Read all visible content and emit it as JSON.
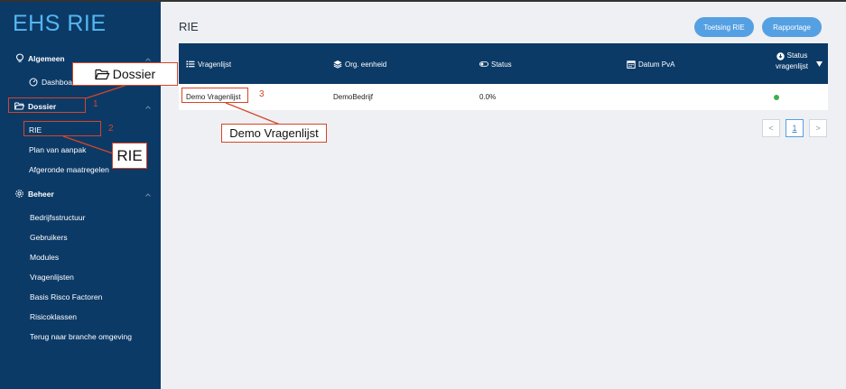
{
  "sidebar": {
    "brand": "EHS RIE",
    "groups": [
      {
        "label": "Algemeen",
        "icon": "bulb-icon"
      },
      {
        "label": "Dossier",
        "icon": "folder-open-icon"
      },
      {
        "label": "Beheer",
        "icon": "gear-icon"
      }
    ],
    "items": {
      "dashboard": "Dashboa",
      "rie": "RIE",
      "plan": "Plan van aanpak",
      "afgerond": "Afgeronde maatregelen",
      "bedrijfsstructuur": "Bedrijfsstructuur",
      "gebruikers": "Gebruikers",
      "modules": "Modules",
      "vragenlijsten": "Vragenlijsten",
      "basis": "Basis Risco Factoren",
      "risicoklassen": "Risicoklassen",
      "terug": "Terug naar branche omgeving"
    }
  },
  "header": {
    "title": "RIE",
    "buttons": {
      "toetsing": "Toetsing RIE",
      "rapportage": "Rapportage"
    }
  },
  "table": {
    "columns": {
      "vragenlijst": "Vragenlijst",
      "org": "Org. eenheid",
      "status": "Status",
      "datum": "Datum PvA",
      "status_vragenlijst_1": "Status",
      "status_vragenlijst_2": "vragenlijst"
    },
    "rows": [
      {
        "vragenlijst": "Demo Vragenlijst",
        "org": "DemoBedrijf",
        "status": "0.0%",
        "status_color": "#3cb04b"
      }
    ]
  },
  "pagination": {
    "prev": "<",
    "page": "1",
    "next": ">"
  },
  "annotations": {
    "dossier_callout": "Dossier",
    "rie_callout": "RIE",
    "demo_callout": "Demo Vragenlijst",
    "num1": "1",
    "num2": "2",
    "num3": "3",
    "color": "#d64527"
  },
  "colors": {
    "sidebar": "#0c3a67",
    "brand": "#55b6f2",
    "accent": "#55a0e2",
    "status_ok": "#3cb04b"
  }
}
